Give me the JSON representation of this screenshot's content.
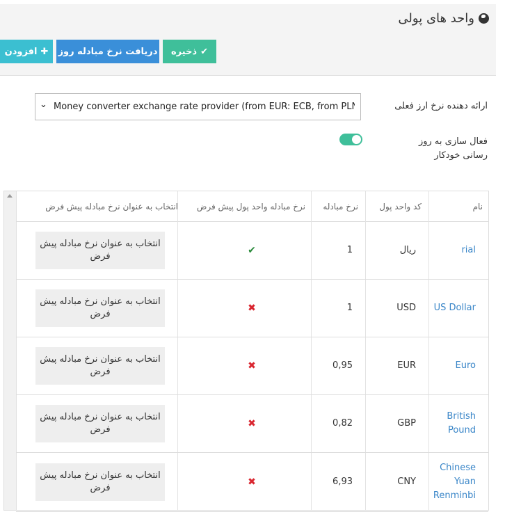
{
  "header": {
    "title": "واحد های پولی",
    "buttons": {
      "save": "ذخیره",
      "fetch_rates": "دریافت نرخ مبادله روز",
      "add": "افزودن"
    }
  },
  "form": {
    "provider_label": "ارائه دهنده نرخ ارز فعلی",
    "provider_value": "Money converter exchange rate provider (from EUR: ECB, from PLN: NBP)",
    "auto_update_label": "فعال سازی به روز رسانی خودکار",
    "auto_update_on": true
  },
  "table": {
    "columns": {
      "name": "نام",
      "code": "کد واحد پول",
      "rate": "نرخ مبادله",
      "is_default": "نرخ مبادله واحد پول پیش فرض",
      "select": "انتخاب به عنوان نرخ مبادله پیش فرض"
    },
    "select_button_label": "انتخاب به عنوان نرخ مبادله پیش فرض",
    "rows": [
      {
        "name": "rial",
        "code": "ریال",
        "rate": "1",
        "is_default": true
      },
      {
        "name": "US Dollar",
        "code": "USD",
        "rate": "1",
        "is_default": false
      },
      {
        "name": "Euro",
        "code": "EUR",
        "rate": "0,95",
        "is_default": false
      },
      {
        "name": "British Pound",
        "code": "GBP",
        "rate": "0,82",
        "is_default": false
      },
      {
        "name": "Chinese Yuan Renminbi",
        "code": "CNY",
        "rate": "6,93",
        "is_default": false
      }
    ]
  },
  "icons": {
    "title": "globe-icon",
    "save": "check-icon",
    "add": "plus-icon",
    "default_yes": "check-icon",
    "default_no": "cross-icon",
    "select": "chevron-down-icon"
  },
  "colors": {
    "save": "#3fbf9a",
    "fetch": "#3a8fd9",
    "add": "#3bbfd1",
    "link": "#3a86c8",
    "tick": "#2a8a3a",
    "cross": "#d9252f"
  }
}
